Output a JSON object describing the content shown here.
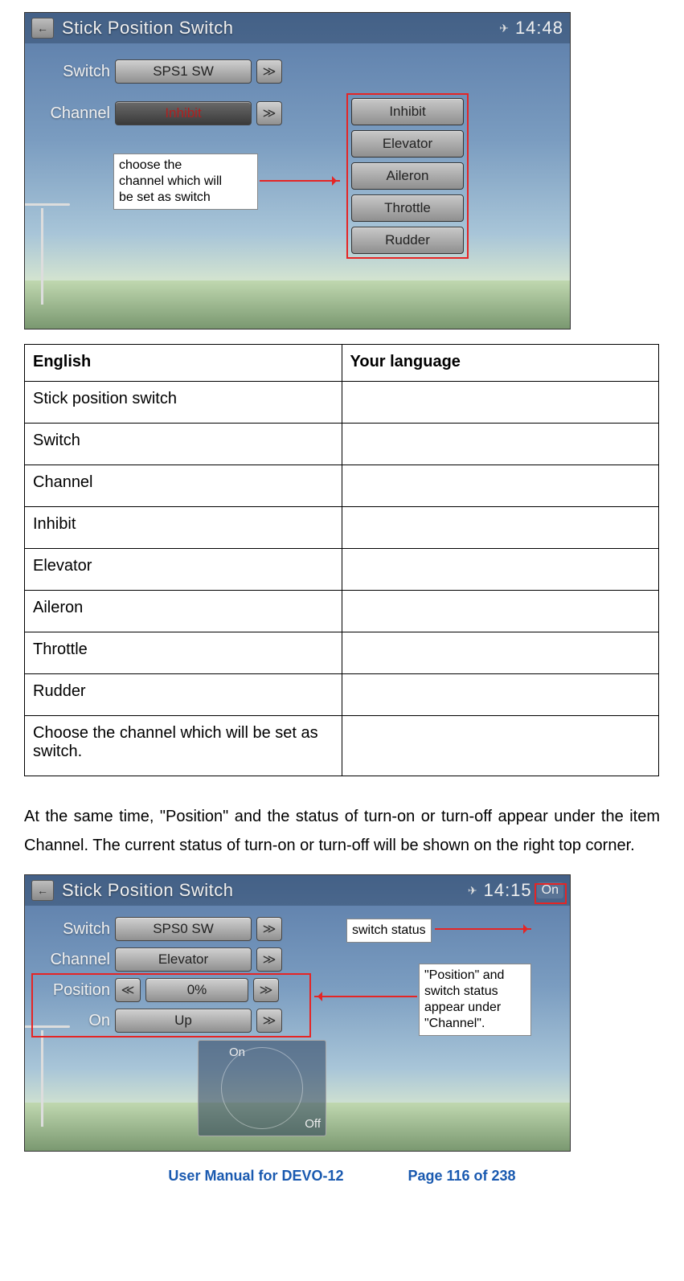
{
  "screenshot1": {
    "title": "Stick Position Switch",
    "time": "14:48",
    "rows": {
      "switch_label": "Switch",
      "switch_value": "SPS1 SW",
      "channel_label": "Channel",
      "channel_value": "Inhibit"
    },
    "dropdown": [
      "Inhibit",
      "Elevator",
      "Aileron",
      "Throttle",
      "Rudder"
    ],
    "callout": "choose the\nchannel which will\nbe set as switch"
  },
  "table": {
    "header_en": "English",
    "header_your": "Your language",
    "rows": [
      "Stick position switch",
      "Switch",
      "Channel",
      "Inhibit",
      "Elevator",
      "Aileron",
      "Throttle",
      "Rudder",
      "Choose the channel which will be set as switch."
    ]
  },
  "paragraph": "At the same time, \"Position\" and the status of turn-on or turn-off appear under the item Channel. The current status of turn-on or turn-off will be shown on the right top corner.",
  "screenshot2": {
    "title": "Stick Position Switch",
    "time": "14:15",
    "status_on": "On",
    "rows": {
      "switch_label": "Switch",
      "switch_value": "SPS0 SW",
      "channel_label": "Channel",
      "channel_value": "Elevator",
      "position_label": "Position",
      "position_value": "0%",
      "on_label": "On",
      "on_value": "Up"
    },
    "radar_on": "On",
    "radar_off": "Off",
    "callout_status": "switch status",
    "callout_position": "\"Position\" and\nswitch status\nappear under\n\"Channel\"."
  },
  "footer": {
    "product": "User Manual for DEVO-12",
    "page": "Page 116 of 238"
  }
}
